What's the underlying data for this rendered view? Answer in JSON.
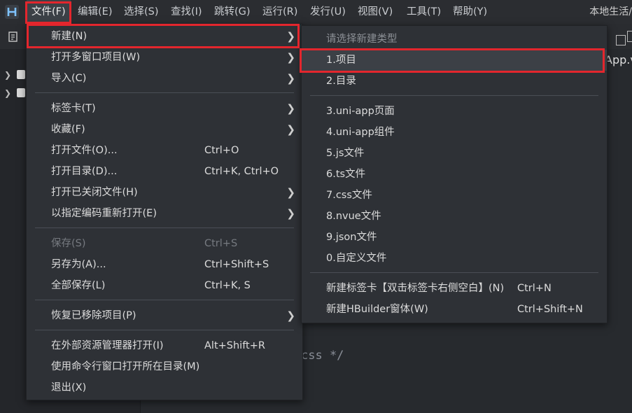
{
  "menubar": {
    "items": [
      "文件(F)",
      "编辑(E)",
      "选择(S)",
      "查找(I)",
      "跳转(G)",
      "运行(R)",
      "发行(U)",
      "视图(V)",
      "工具(T)",
      "帮助(Y)"
    ],
    "right_text": "本地生活/"
  },
  "editor": {
    "tab_partial": "App.v",
    "code_partial": "css */"
  },
  "file_menu": {
    "items": [
      {
        "label": "新建(N)",
        "shortcut": "",
        "submenu": true,
        "disabled": false
      },
      {
        "label": "打开多窗口项目(W)",
        "shortcut": "",
        "submenu": true,
        "disabled": false
      },
      {
        "label": "导入(C)",
        "shortcut": "",
        "submenu": true,
        "disabled": false
      },
      {
        "label": "标签卡(T)",
        "shortcut": "",
        "submenu": true,
        "disabled": false
      },
      {
        "label": "收藏(F)",
        "shortcut": "",
        "submenu": true,
        "disabled": false
      },
      {
        "label": "打开文件(O)...",
        "shortcut": "Ctrl+O",
        "submenu": false,
        "disabled": false
      },
      {
        "label": "打开目录(D)...",
        "shortcut": "Ctrl+K, Ctrl+O",
        "submenu": false,
        "disabled": false
      },
      {
        "label": "打开已关闭文件(H)",
        "shortcut": "",
        "submenu": true,
        "disabled": false
      },
      {
        "label": "以指定编码重新打开(E)",
        "shortcut": "",
        "submenu": true,
        "disabled": false
      },
      {
        "label": "保存(S)",
        "shortcut": "Ctrl+S",
        "submenu": false,
        "disabled": true
      },
      {
        "label": "另存为(A)...",
        "shortcut": "Ctrl+Shift+S",
        "submenu": false,
        "disabled": false
      },
      {
        "label": "全部保存(L)",
        "shortcut": "Ctrl+K, S",
        "submenu": false,
        "disabled": false
      },
      {
        "label": "恢复已移除项目(P)",
        "shortcut": "",
        "submenu": true,
        "disabled": false
      },
      {
        "label": "在外部资源管理器打开(I)",
        "shortcut": "Alt+Shift+R",
        "submenu": false,
        "disabled": false
      },
      {
        "label": "使用命令行窗口打开所在目录(M)",
        "shortcut": "",
        "submenu": false,
        "disabled": false
      },
      {
        "label": "退出(X)",
        "shortcut": "",
        "submenu": false,
        "disabled": false
      }
    ]
  },
  "new_submenu": {
    "header": "请选择新建类型",
    "items": [
      {
        "label": "1.项目",
        "shortcut": ""
      },
      {
        "label": "2.目录",
        "shortcut": ""
      },
      {
        "label": "3.uni-app页面",
        "shortcut": ""
      },
      {
        "label": "4.uni-app组件",
        "shortcut": ""
      },
      {
        "label": "5.js文件",
        "shortcut": ""
      },
      {
        "label": "6.ts文件",
        "shortcut": ""
      },
      {
        "label": "7.css文件",
        "shortcut": ""
      },
      {
        "label": "8.nvue文件",
        "shortcut": ""
      },
      {
        "label": "9.json文件",
        "shortcut": ""
      },
      {
        "label": "0.自定义文件",
        "shortcut": ""
      },
      {
        "label": "新建标签卡【双击标签卡右侧空白】(N)",
        "shortcut": "Ctrl+N"
      },
      {
        "label": "新建HBuilder窗体(W)",
        "shortcut": "Ctrl+Shift+N"
      }
    ]
  },
  "colors": {
    "highlight": "#e3262d",
    "menu_bg": "#2e3136",
    "hover": "#3c4046"
  }
}
